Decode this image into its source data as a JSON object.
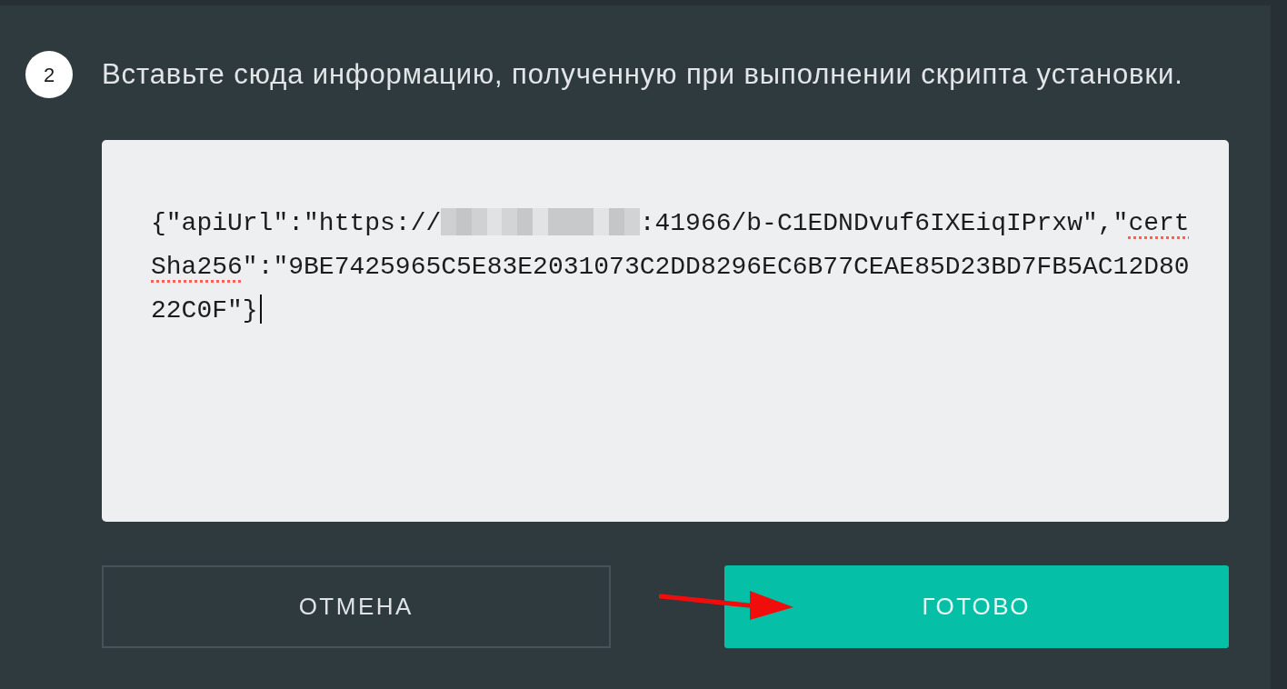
{
  "step": {
    "number": "2",
    "instruction": "Вставьте сюда информацию, полученную при выполнении скрипта установки."
  },
  "config_field": {
    "focused": true,
    "segments": [
      {
        "kind": "text",
        "text": "{\"apiUrl\":\"https://"
      },
      {
        "kind": "redacted"
      },
      {
        "kind": "text",
        "text": ":41966/b-C1EDNDvuf6IXEiqIPrxw\",\""
      },
      {
        "kind": "misspelled",
        "text": "certSha256"
      },
      {
        "kind": "text",
        "text": "\":\"9BE7425965C5E83E2031073C2DD8296EC6B77CEAE85D23BD7FB5AC12D8022C0F\"}"
      }
    ]
  },
  "buttons": [
    {
      "kind": "secondary",
      "label": "ОТМЕНА"
    },
    {
      "kind": "primary",
      "label": "ГОТОВО"
    }
  ]
}
